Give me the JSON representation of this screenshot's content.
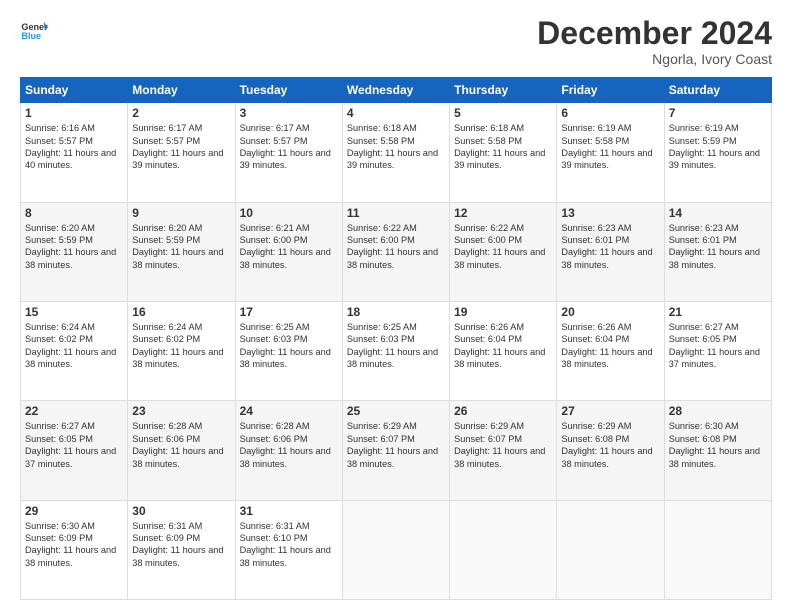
{
  "logo": {
    "line1": "General",
    "line2": "Blue"
  },
  "title": "December 2024",
  "location": "Ngorla, Ivory Coast",
  "days_of_week": [
    "Sunday",
    "Monday",
    "Tuesday",
    "Wednesday",
    "Thursday",
    "Friday",
    "Saturday"
  ],
  "weeks": [
    [
      {
        "day": 1,
        "sunrise": "6:16 AM",
        "sunset": "5:57 PM",
        "daylight": "11 hours and 40 minutes."
      },
      {
        "day": 2,
        "sunrise": "6:17 AM",
        "sunset": "5:57 PM",
        "daylight": "11 hours and 39 minutes."
      },
      {
        "day": 3,
        "sunrise": "6:17 AM",
        "sunset": "5:57 PM",
        "daylight": "11 hours and 39 minutes."
      },
      {
        "day": 4,
        "sunrise": "6:18 AM",
        "sunset": "5:58 PM",
        "daylight": "11 hours and 39 minutes."
      },
      {
        "day": 5,
        "sunrise": "6:18 AM",
        "sunset": "5:58 PM",
        "daylight": "11 hours and 39 minutes."
      },
      {
        "day": 6,
        "sunrise": "6:19 AM",
        "sunset": "5:58 PM",
        "daylight": "11 hours and 39 minutes."
      },
      {
        "day": 7,
        "sunrise": "6:19 AM",
        "sunset": "5:59 PM",
        "daylight": "11 hours and 39 minutes."
      }
    ],
    [
      {
        "day": 8,
        "sunrise": "6:20 AM",
        "sunset": "5:59 PM",
        "daylight": "11 hours and 38 minutes."
      },
      {
        "day": 9,
        "sunrise": "6:20 AM",
        "sunset": "5:59 PM",
        "daylight": "11 hours and 38 minutes."
      },
      {
        "day": 10,
        "sunrise": "6:21 AM",
        "sunset": "6:00 PM",
        "daylight": "11 hours and 38 minutes."
      },
      {
        "day": 11,
        "sunrise": "6:22 AM",
        "sunset": "6:00 PM",
        "daylight": "11 hours and 38 minutes."
      },
      {
        "day": 12,
        "sunrise": "6:22 AM",
        "sunset": "6:00 PM",
        "daylight": "11 hours and 38 minutes."
      },
      {
        "day": 13,
        "sunrise": "6:23 AM",
        "sunset": "6:01 PM",
        "daylight": "11 hours and 38 minutes."
      },
      {
        "day": 14,
        "sunrise": "6:23 AM",
        "sunset": "6:01 PM",
        "daylight": "11 hours and 38 minutes."
      }
    ],
    [
      {
        "day": 15,
        "sunrise": "6:24 AM",
        "sunset": "6:02 PM",
        "daylight": "11 hours and 38 minutes."
      },
      {
        "day": 16,
        "sunrise": "6:24 AM",
        "sunset": "6:02 PM",
        "daylight": "11 hours and 38 minutes."
      },
      {
        "day": 17,
        "sunrise": "6:25 AM",
        "sunset": "6:03 PM",
        "daylight": "11 hours and 38 minutes."
      },
      {
        "day": 18,
        "sunrise": "6:25 AM",
        "sunset": "6:03 PM",
        "daylight": "11 hours and 38 minutes."
      },
      {
        "day": 19,
        "sunrise": "6:26 AM",
        "sunset": "6:04 PM",
        "daylight": "11 hours and 38 minutes."
      },
      {
        "day": 20,
        "sunrise": "6:26 AM",
        "sunset": "6:04 PM",
        "daylight": "11 hours and 38 minutes."
      },
      {
        "day": 21,
        "sunrise": "6:27 AM",
        "sunset": "6:05 PM",
        "daylight": "11 hours and 37 minutes."
      }
    ],
    [
      {
        "day": 22,
        "sunrise": "6:27 AM",
        "sunset": "6:05 PM",
        "daylight": "11 hours and 37 minutes."
      },
      {
        "day": 23,
        "sunrise": "6:28 AM",
        "sunset": "6:06 PM",
        "daylight": "11 hours and 38 minutes."
      },
      {
        "day": 24,
        "sunrise": "6:28 AM",
        "sunset": "6:06 PM",
        "daylight": "11 hours and 38 minutes."
      },
      {
        "day": 25,
        "sunrise": "6:29 AM",
        "sunset": "6:07 PM",
        "daylight": "11 hours and 38 minutes."
      },
      {
        "day": 26,
        "sunrise": "6:29 AM",
        "sunset": "6:07 PM",
        "daylight": "11 hours and 38 minutes."
      },
      {
        "day": 27,
        "sunrise": "6:29 AM",
        "sunset": "6:08 PM",
        "daylight": "11 hours and 38 minutes."
      },
      {
        "day": 28,
        "sunrise": "6:30 AM",
        "sunset": "6:08 PM",
        "daylight": "11 hours and 38 minutes."
      }
    ],
    [
      {
        "day": 29,
        "sunrise": "6:30 AM",
        "sunset": "6:09 PM",
        "daylight": "11 hours and 38 minutes."
      },
      {
        "day": 30,
        "sunrise": "6:31 AM",
        "sunset": "6:09 PM",
        "daylight": "11 hours and 38 minutes."
      },
      {
        "day": 31,
        "sunrise": "6:31 AM",
        "sunset": "6:10 PM",
        "daylight": "11 hours and 38 minutes."
      },
      null,
      null,
      null,
      null
    ]
  ]
}
